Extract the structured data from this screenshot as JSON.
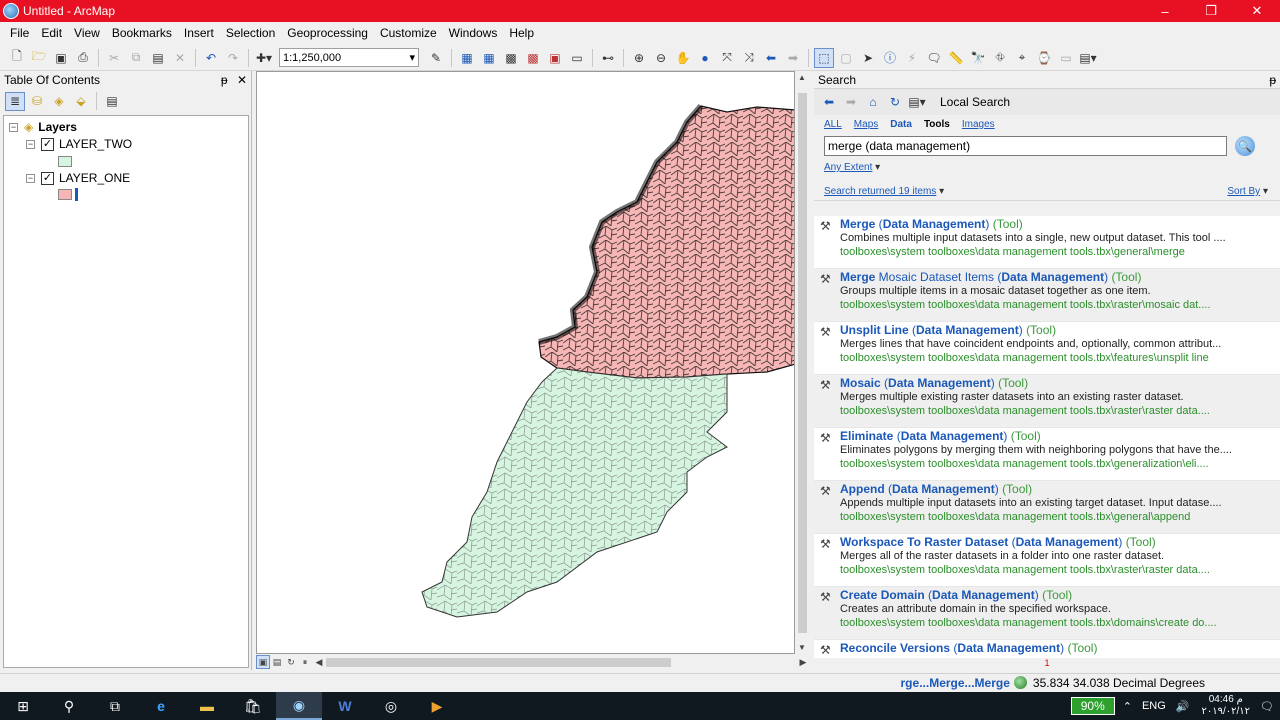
{
  "window": {
    "title": "Untitled - ArcMap",
    "minimize": "–",
    "restore": "❐",
    "close": "✕"
  },
  "menu": [
    "File",
    "Edit",
    "View",
    "Bookmarks",
    "Insert",
    "Selection",
    "Geoprocessing",
    "Customize",
    "Windows",
    "Help"
  ],
  "toolbar": {
    "scale": "1:1,250,000"
  },
  "toc": {
    "title": "Table Of Contents",
    "pin": "ᵽ",
    "close": "✕",
    "root": "Layers",
    "layers": [
      {
        "name": "LAYER_TWO",
        "checked": "✓",
        "color": "#d6f5e0"
      },
      {
        "name": "LAYER_ONE",
        "checked": "✓",
        "color": "#f7b6b6"
      }
    ]
  },
  "search": {
    "title": "Search",
    "pin": "ᵽ",
    "local_search": "Local Search",
    "tabs": [
      "ALL",
      "Maps",
      "Data",
      "Tools",
      "Images"
    ],
    "query": "merge (data management)",
    "any_extent": "Any Extent",
    "returned": "Search returned 19 items",
    "sort_by": "Sort By",
    "results": [
      {
        "title_parts": [
          "Merge",
          " (",
          "Data Management",
          ") "
        ],
        "tool": "(Tool)",
        "desc": "Combines multiple input datasets into a single, new output dataset. This tool ....",
        "path": "toolboxes\\system toolboxes\\data management tools.tbx\\general\\merge"
      },
      {
        "title_parts": [
          "Merge",
          " Mosaic Dataset Items (",
          "Data Management",
          ") "
        ],
        "tool": "(Tool)",
        "desc": "Groups multiple items in a mosaic dataset together as one item.",
        "path": "toolboxes\\system toolboxes\\data management tools.tbx\\raster\\mosaic dat...."
      },
      {
        "title_parts": [
          "Unsplit Line",
          " (",
          "Data Management",
          ") "
        ],
        "tool": "(Tool)",
        "desc": "Merges lines that have coincident endpoints and, optionally, common attribut...",
        "path": "toolboxes\\system toolboxes\\data management tools.tbx\\features\\unsplit line"
      },
      {
        "title_parts": [
          "Mosaic",
          " (",
          "Data Management",
          ") "
        ],
        "tool": "(Tool)",
        "desc": "Merges multiple existing raster datasets into an existing raster dataset.",
        "path": "toolboxes\\system toolboxes\\data management tools.tbx\\raster\\raster data...."
      },
      {
        "title_parts": [
          "Eliminate",
          " (",
          "Data Management",
          ") "
        ],
        "tool": "(Tool)",
        "desc": "Eliminates polygons by merging them with neighboring polygons that have the....",
        "path": "toolboxes\\system toolboxes\\data management tools.tbx\\generalization\\eli...."
      },
      {
        "title_parts": [
          "Append",
          " (",
          "Data Management",
          ") "
        ],
        "tool": "(Tool)",
        "desc": "Appends multiple input datasets into an existing target dataset. Input datase....",
        "path": "toolboxes\\system toolboxes\\data management tools.tbx\\general\\append"
      },
      {
        "title_parts": [
          "Workspace To Raster Dataset",
          " (",
          "Data Management",
          ") "
        ],
        "tool": "(Tool)",
        "desc": "Merges all of the raster datasets in a folder into one raster dataset.",
        "path": "toolboxes\\system toolboxes\\data management tools.tbx\\raster\\raster data...."
      },
      {
        "title_parts": [
          "Create Domain",
          " (",
          "Data Management",
          ") "
        ],
        "tool": "(Tool)",
        "desc": "Creates an attribute domain in the specified workspace.",
        "path": "toolboxes\\system toolboxes\\data management tools.tbx\\domains\\create do...."
      },
      {
        "title_parts": [
          "Reconcile Versions",
          " (",
          "Data Management",
          ") "
        ],
        "tool": "(Tool)",
        "desc": "",
        "path": ""
      }
    ],
    "footer_marker": "1"
  },
  "status": {
    "merge_text": "rge...Merge...Merge",
    "coords": "35.834  34.038 Decimal Degrees"
  },
  "taskbar": {
    "battery": "90%",
    "lang": "ENG",
    "time": "04:46 م",
    "date": "٢٠١٩/٠٢/١٢"
  },
  "colors": {
    "titlebar": "#e81123",
    "layer_one": "#f7b6b6",
    "layer_two": "#d6f5e0",
    "link": "#1b58b8",
    "path_green": "#2b8f2b"
  }
}
